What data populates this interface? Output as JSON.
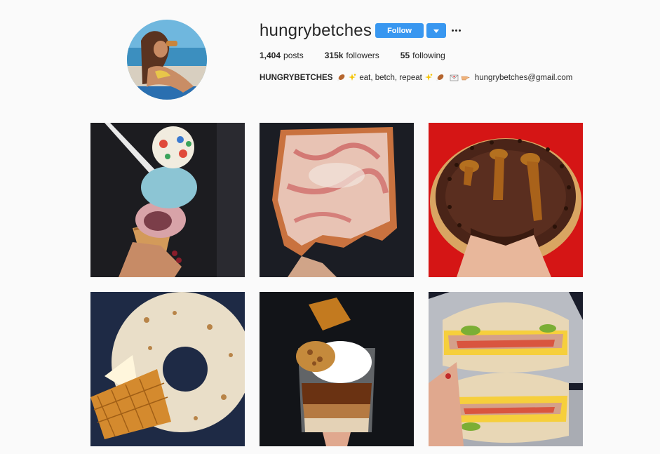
{
  "profile": {
    "username": "hungrybetches",
    "follow_label": "Follow",
    "stats": {
      "posts_value": "1,404",
      "posts_label": "posts",
      "followers_value": "315k",
      "followers_label": "followers",
      "following_value": "55",
      "following_label": "following"
    },
    "bio": {
      "name": "HUNGRYBETCHES",
      "text1": "eat, betch, repeat",
      "email": "hungrybetches@gmail.com"
    }
  },
  "colors": {
    "accent": "#3897f0",
    "background": "#fafafa",
    "text": "#262626"
  },
  "icons": {
    "more": "ellipsis-icon",
    "dropdown": "caret-down-icon",
    "bio_emojis": [
      "drumstick-emoji",
      "sparkles-emoji",
      "sparkles-emoji",
      "drumstick-emoji",
      "envelope-emoji",
      "pointing-hand-emoji"
    ]
  },
  "posts": [
    {
      "subject": "rainbow-ice-cream-cone"
    },
    {
      "subject": "square-pizza-slice"
    },
    {
      "subject": "chocolate-caramel-donut"
    },
    {
      "subject": "glazed-donut-with-waffle-cone"
    },
    {
      "subject": "layered-coffee-dessert-jar"
    },
    {
      "subject": "egg-bagel-sandwich"
    }
  ]
}
